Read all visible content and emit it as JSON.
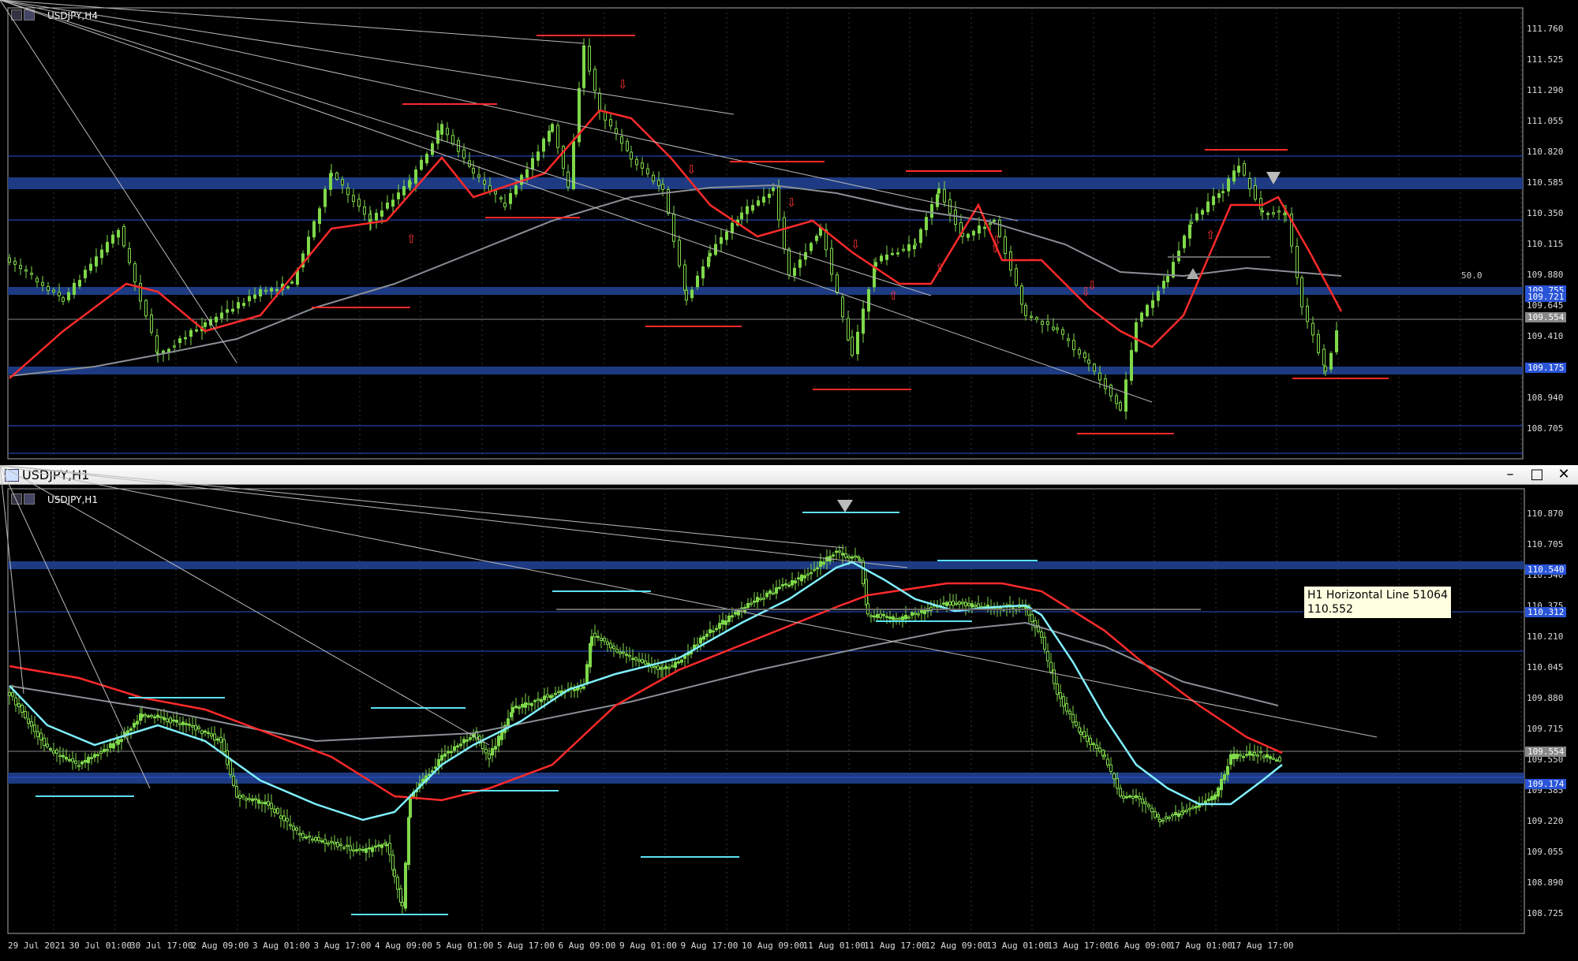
{
  "top_chart": {
    "label": "USDJPY,H4",
    "price_axis": [
      "111.760",
      "111.525",
      "111.290",
      "111.055",
      "110.820",
      "110.585",
      "110.350",
      "110.115",
      "109.880",
      "109.645",
      "109.410",
      "109.175",
      "108.940",
      "108.705"
    ],
    "badges": [
      {
        "text": "109.755",
        "kind": "blue"
      },
      {
        "text": "109.721",
        "kind": "blue"
      },
      {
        "text": "109.554",
        "kind": "gray"
      },
      {
        "text": "109.175",
        "kind": "blue"
      }
    ],
    "level_text": "50.0"
  },
  "bottom_window": {
    "title": "USDJPY,H1",
    "minimize_label": "–",
    "maximize_label": "□",
    "close_label": "✕"
  },
  "bottom_chart": {
    "label": "USDJPY,H1",
    "price_axis": [
      "110.870",
      "110.705",
      "110.540",
      "110.375",
      "110.210",
      "110.045",
      "109.880",
      "109.715",
      "109.550",
      "109.385",
      "109.220",
      "109.055",
      "108.890",
      "108.725"
    ],
    "badges": [
      {
        "text": "110.540",
        "kind": "blue"
      },
      {
        "text": "110.312",
        "kind": "blue"
      },
      {
        "text": "109.554",
        "kind": "gray"
      },
      {
        "text": "109.174",
        "kind": "blue"
      }
    ],
    "tooltip": {
      "line1": "H1 Horizontal Line 51064",
      "line2": "110.552"
    },
    "time_axis": [
      "29 Jul 2021",
      "30 Jul 01:00",
      "30 Jul 17:00",
      "2 Aug 09:00",
      "3 Aug 01:00",
      "3 Aug 17:00",
      "4 Aug 09:00",
      "5 Aug 01:00",
      "5 Aug 17:00",
      "6 Aug 09:00",
      "9 Aug 01:00",
      "9 Aug 17:00",
      "10 Aug 09:00",
      "11 Aug 01:00",
      "11 Aug 17:00",
      "12 Aug 09:00",
      "13 Aug 01:00",
      "13 Aug 17:00",
      "16 Aug 09:00",
      "17 Aug 01:00",
      "17 Aug 17:00"
    ]
  },
  "colors": {
    "candle": "#7fd94a",
    "ma_red": "#ff2a2a",
    "ma_cyan": "#7ff0ff",
    "ma_gray": "#8a8f96",
    "zone_blue": "#1f3d8a",
    "hline_blue": "#2c54d6",
    "axis_text": "#e0e0e0"
  }
}
